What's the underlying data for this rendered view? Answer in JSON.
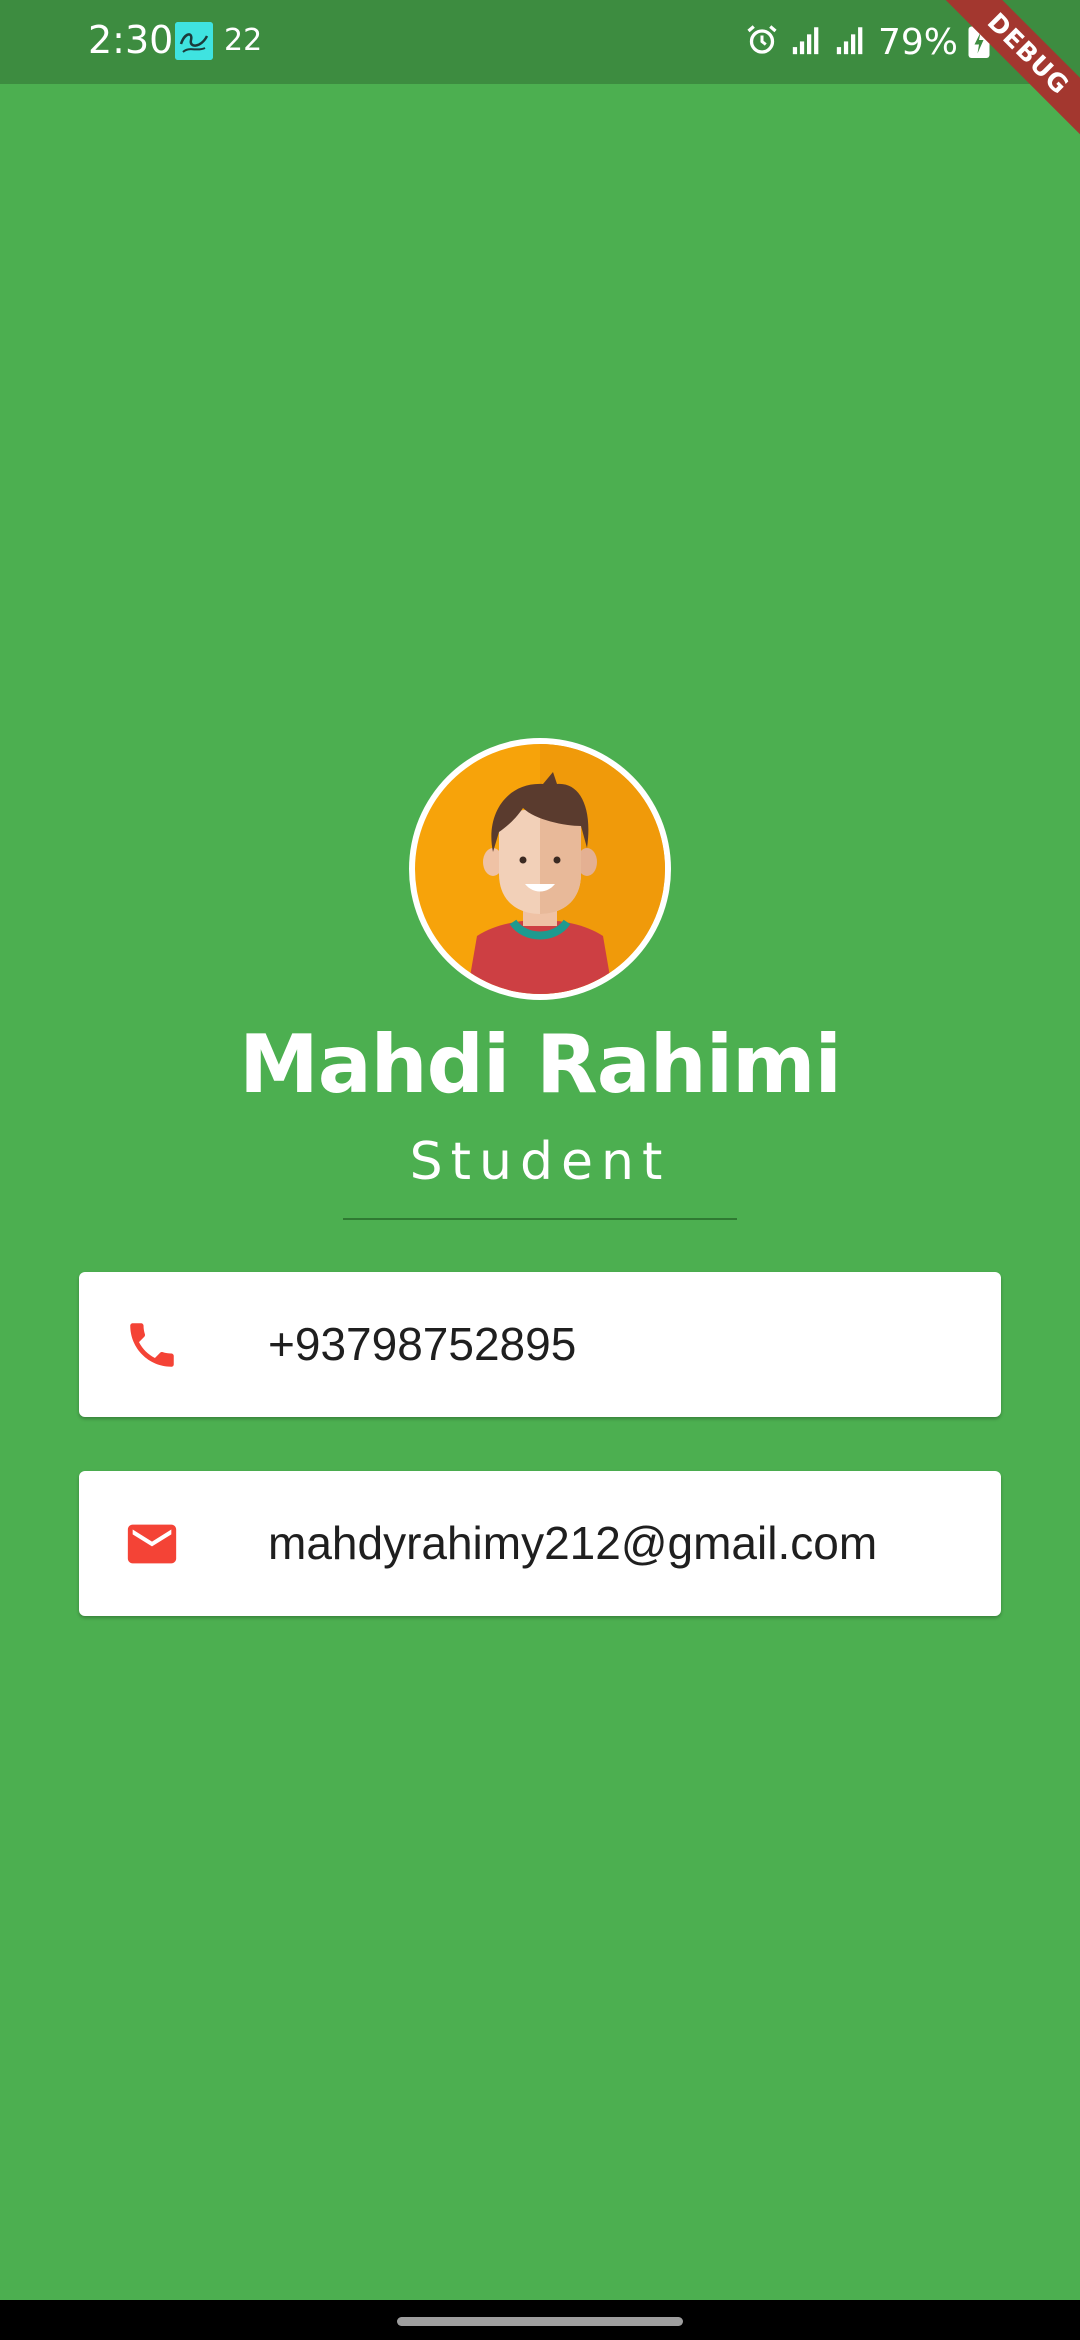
{
  "status_bar": {
    "time": "2:30",
    "notification_count": "22",
    "battery_percent": "79%"
  },
  "debug_banner": {
    "label": "DEBUG"
  },
  "profile": {
    "name": "Mahdi Rahimi",
    "title": "Student",
    "avatar_icon": "person-avatar"
  },
  "contacts": {
    "phone": {
      "icon": "phone-icon",
      "value": "+93798752895"
    },
    "email": {
      "icon": "mail-icon",
      "value": "mahdyrahimy212@gmail.com"
    }
  },
  "colors": {
    "background": "#4caf50",
    "status_bar": "#3d8c40",
    "icon_accent": "#f44336",
    "card": "#ffffff"
  }
}
